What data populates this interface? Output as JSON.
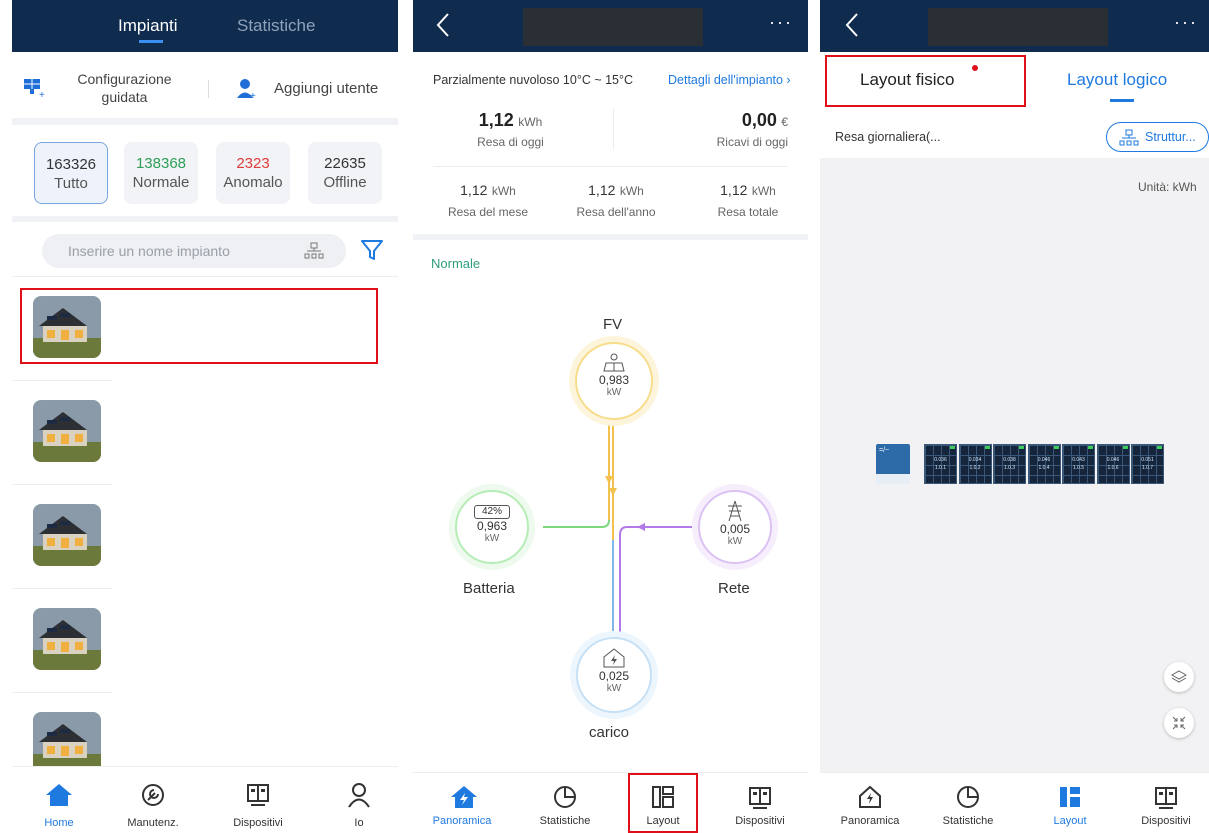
{
  "p1": {
    "tabs": [
      "Impianti",
      "Statistiche"
    ],
    "actions": {
      "guided": "Configurazione guidata",
      "adduser": "Aggiungi utente"
    },
    "counts": [
      {
        "n": "163326",
        "l": "Tutto",
        "c": "#333"
      },
      {
        "n": "138368",
        "l": "Normale",
        "c": "#2e9e57"
      },
      {
        "n": "2323",
        "l": "Anomalo",
        "c": "#e03a3a"
      },
      {
        "n": "22635",
        "l": "Offline",
        "c": "#333"
      }
    ],
    "search_placeholder": "Inserire un nome impianto",
    "nav": [
      "Home",
      "Manutenz.",
      "Dispositivi",
      "Io"
    ]
  },
  "p2": {
    "weather": "Parzialmente nuvoloso 10°C ~ 15°C",
    "details": "Dettagli dell'impianto",
    "today_yield": {
      "v": "1,12",
      "u": "kWh",
      "l": "Resa di oggi"
    },
    "today_rev": {
      "v": "0,00",
      "u": "€",
      "l": "Ricavi di oggi"
    },
    "stats": [
      {
        "v": "1,12",
        "u": "kWh",
        "l": "Resa del mese"
      },
      {
        "v": "1,12",
        "u": "kWh",
        "l": "Resa dell'anno"
      },
      {
        "v": "1,12",
        "u": "kWh",
        "l": "Resa totale"
      }
    ],
    "status": "Normale",
    "pv": {
      "label": "FV",
      "value": "0,983",
      "unit": "kW"
    },
    "battery": {
      "label": "Batteria",
      "value": "0,963",
      "unit": "kW",
      "soc": "42%"
    },
    "grid": {
      "label": "Rete",
      "value": "0,005",
      "unit": "kW"
    },
    "load": {
      "label": "carico",
      "value": "0,025",
      "unit": "kW"
    },
    "nav": [
      "Panoramica",
      "Statistiche",
      "Layout",
      "Dispositivi"
    ]
  },
  "p3": {
    "tabs": [
      "Layout fisico",
      "Layout logico"
    ],
    "daily": "Resa giornaliera(...",
    "struct_btn": "Struttur...",
    "unit": "Unità: kWh",
    "nav": [
      "Panoramica",
      "Statistiche",
      "Layout",
      "Dispositivi"
    ],
    "modules": [
      {
        "v": "0.036",
        "id": "1.0.1"
      },
      {
        "v": "0.034",
        "id": "1.0.2"
      },
      {
        "v": "0.038",
        "id": "1.0.3"
      },
      {
        "v": "0.046",
        "id": "1.0.4"
      },
      {
        "v": "0.043",
        "id": "1.0.5"
      },
      {
        "v": "0.046",
        "id": "1.0.6"
      },
      {
        "v": "0.051",
        "id": "1.0.7"
      }
    ]
  },
  "colors": {
    "accent": "#1f7ae0",
    "header": "#0f2b4e",
    "pv": "#f2c14e",
    "battery": "#7dd87d",
    "grid": "#b07ae8",
    "load": "#7fb8e8",
    "red": "#e0101a"
  }
}
